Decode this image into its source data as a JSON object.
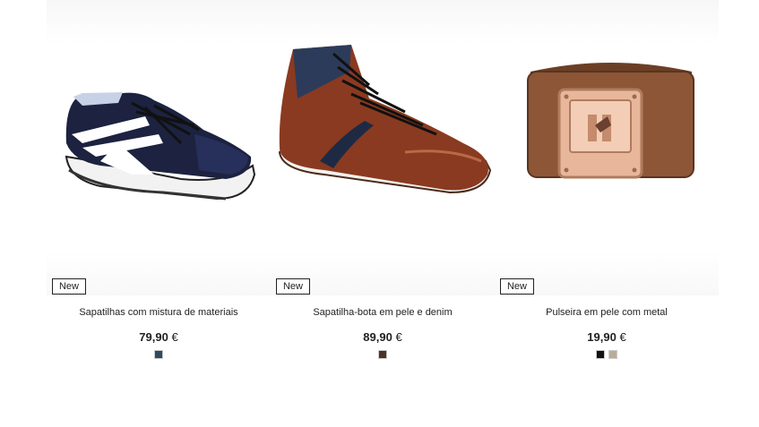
{
  "products": [
    {
      "badge": "New",
      "name": "Sapatilhas com mistura de materiais",
      "price": "79,90",
      "currency": "€",
      "image_icon": "sneaker-icon",
      "swatches": [
        "#2f4a63"
      ]
    },
    {
      "badge": "New",
      "name": "Sapatilha-bota em pele e denim",
      "price": "89,90",
      "currency": "€",
      "image_icon": "boot-icon",
      "swatches": [
        "#4a3326"
      ]
    },
    {
      "badge": "New",
      "name": "Pulseira em pele com metal",
      "price": "19,90",
      "currency": "€",
      "image_icon": "bracelet-icon",
      "swatches": [
        "#111111",
        "#b9ad99"
      ]
    }
  ]
}
